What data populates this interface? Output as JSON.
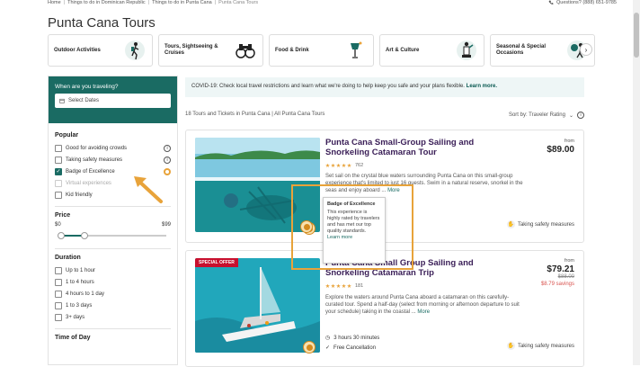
{
  "breadcrumbs": [
    "Home",
    "Things to do in Dominican Republic",
    "Things to do in Punta Cana",
    "Punta Cana Tours"
  ],
  "contact": "Questions? (888) 651-9785",
  "page_title": "Punta Cana Tours",
  "categories": [
    {
      "label": "Outdoor Activities",
      "icon": "hiker-icon"
    },
    {
      "label": "Tours, Sightseeing & Cruises",
      "icon": "binoculars-icon"
    },
    {
      "label": "Food & Drink",
      "icon": "glass-icon"
    },
    {
      "label": "Art & Culture",
      "icon": "statue-icon"
    },
    {
      "label": "Seasonal & Special Occasions",
      "icon": "celebration-icon"
    }
  ],
  "sidebar": {
    "when_label": "When are you traveling?",
    "date_placeholder": "Select Dates",
    "popular_title": "Popular",
    "popular": [
      {
        "label": "Good for avoiding crowds",
        "checked": false
      },
      {
        "label": "Taking safety measures",
        "checked": false
      },
      {
        "label": "Badge of Excellence",
        "checked": true
      },
      {
        "label": "Virtual experiences",
        "checked": false
      },
      {
        "label": "Kid friendly",
        "checked": false
      }
    ],
    "price_title": "Price",
    "price_min": "$0",
    "price_max": "$99",
    "duration_title": "Duration",
    "durations": [
      "Up to 1 hour",
      "1 to 4 hours",
      "4 hours to 1 day",
      "1 to 3 days",
      "3+ days"
    ],
    "time_title": "Time of Day"
  },
  "banner": {
    "text": "COVID-19: Check local travel restrictions and learn what we're doing to help keep you safe and your plans flexible.",
    "link": "Learn more."
  },
  "results": {
    "count_text": "18 Tours and Tickets in Punta Cana | All Punta Cana Tours",
    "sort_label": "Sort by: Traveler Rating"
  },
  "cards": [
    {
      "title": "Punta Cana Small-Group Sailing and Snorkeling Catamaran Tour",
      "reviews": "762",
      "description": "Set sail on the crystal blue waters surrounding Punta Cana on this small-group experience that's limited to just 16 guests. Swim in a natural reserve, snorkel in the seas and enjoy aboard ...",
      "more": "More",
      "from": "from",
      "price": "$89.00",
      "safety": "Taking safety measures"
    },
    {
      "badge": "SPECIAL OFFER",
      "title": "Punta Cana Small Group Sailing and Snorkeling Catamaran Trip",
      "reviews": "181",
      "description": "Explore the waters around Punta Cana aboard a catamaran on this carefully-curated tour. Spend a half-day (select from morning or afternoon departure to suit your schedule) taking in the coastal ...",
      "more": "More",
      "from": "from",
      "price": "$79.21",
      "old_price": "$88.00",
      "savings": "$8.79 savings",
      "duration": "3 hours 30 minutes",
      "cancellation": "Free Cancellation",
      "safety": "Taking safety measures"
    }
  ],
  "tooltip": {
    "title": "Badge of Excellence",
    "body": "This experience is highly rated by travelers and has met our top quality standards.",
    "link": "Learn more"
  },
  "colors": {
    "brand": "#1a6b63",
    "highlight": "#e8a33a",
    "title": "#3a1e57",
    "sale": "#c8102e"
  }
}
